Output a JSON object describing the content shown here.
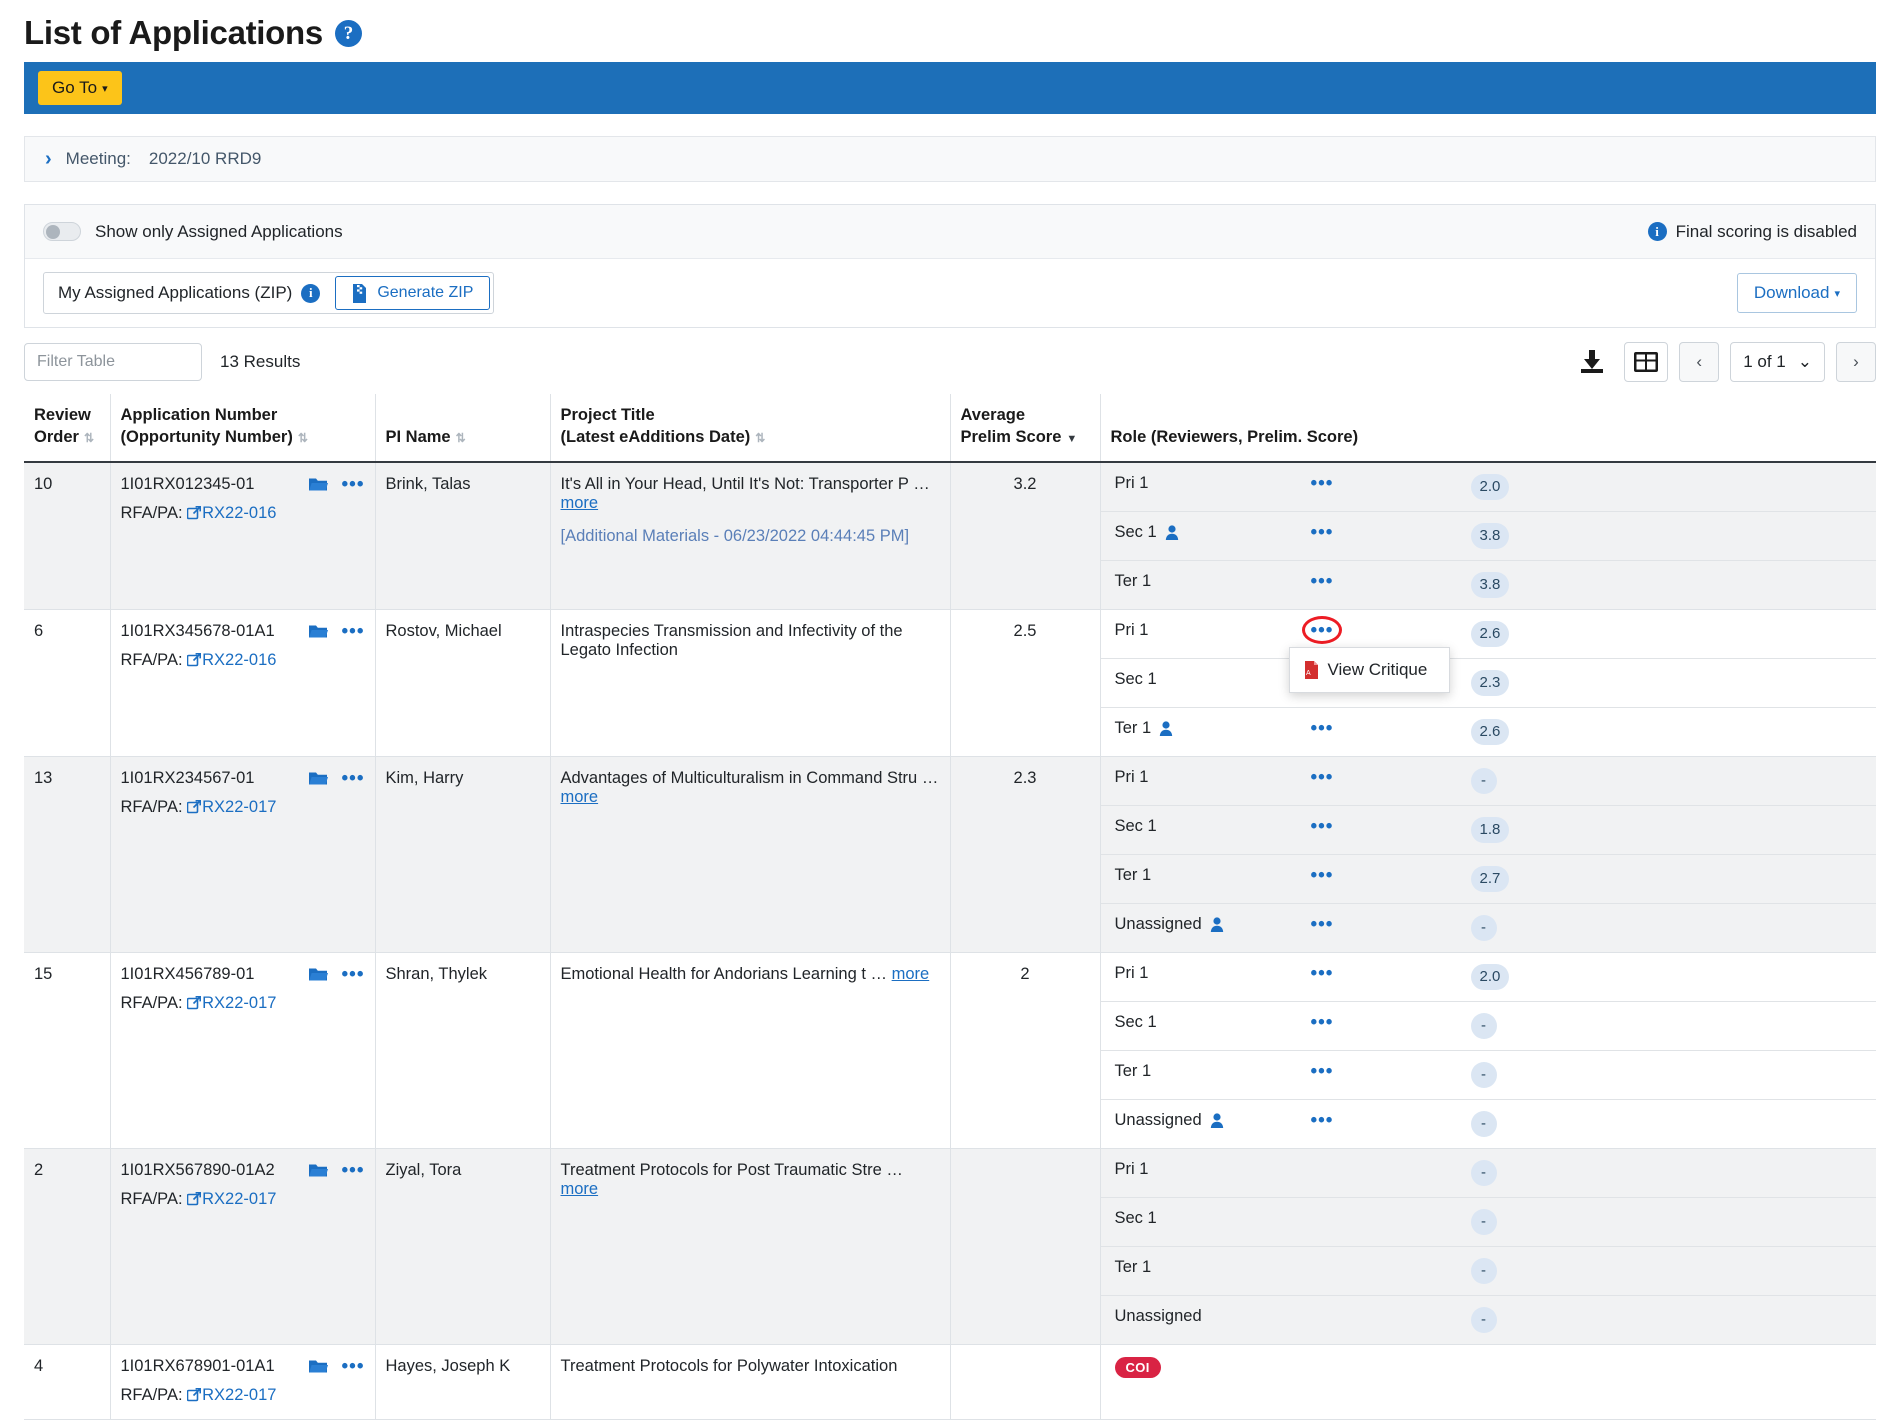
{
  "page": {
    "title": "List of Applications",
    "help_icon": "question-help-icon"
  },
  "navbar": {
    "goto_label": "Go To",
    "goto_caret": "▾"
  },
  "meeting": {
    "chevron": "›",
    "label": "Meeting:",
    "value": "2022/10 RRD9"
  },
  "options": {
    "show_assigned_label": "Show only Assigned Applications",
    "show_assigned_on": false,
    "final_scoring_note": "Final scoring is disabled",
    "zip_label": "My Assigned Applications (ZIP)",
    "generate_zip_label": "Generate ZIP",
    "download_label": "Download",
    "download_caret": "▾"
  },
  "filterbar": {
    "filter_placeholder": "Filter Table",
    "filter_value": "",
    "results_text": "13 Results",
    "page_indicator": "1 of 1",
    "prev_label": "‹",
    "next_label": "›",
    "page_caret": "⌄"
  },
  "table": {
    "headers": [
      {
        "line1": "Review",
        "line2": "Order",
        "sort": "both"
      },
      {
        "line1": "Application Number",
        "line2": "(Opportunity Number)",
        "sort": "both"
      },
      {
        "line1": "",
        "line2": "PI Name",
        "sort": "both"
      },
      {
        "line1": "Project Title",
        "line2": "(Latest eAdditions Date)",
        "sort": "both"
      },
      {
        "line1": "Average",
        "line2": "Prelim Score",
        "sort": "desc"
      },
      {
        "line1": "",
        "line2": "Role (Reviewers, Prelim. Score)",
        "sort": "none"
      }
    ],
    "rfa_prefix": "RFA/PA:",
    "more_label": "more",
    "rows": [
      {
        "review_order": "10",
        "app_number": "1I01RX012345-01",
        "rfa": "RX22-016",
        "pi_name": "Brink, Talas",
        "title": "It's All in Your Head, Until It's Not: Transporter P",
        "title_truncated": true,
        "additional_materials": "[Additional Materials - 06/23/2022 04:44:45 PM]",
        "avg_score": "3.2",
        "coi": false,
        "roles": [
          {
            "name": "Pri 1",
            "person": false,
            "dots": true,
            "score": "2.0"
          },
          {
            "name": "Sec 1",
            "person": true,
            "dots": true,
            "score": "3.8"
          },
          {
            "name": "Ter 1",
            "person": false,
            "dots": true,
            "score": "3.8"
          }
        ]
      },
      {
        "review_order": "6",
        "app_number": "1I01RX345678-01A1",
        "rfa": "RX22-016",
        "pi_name": "Rostov, Michael",
        "title": "Intraspecies Transmission and Infectivity of the Legato Infection",
        "title_truncated": false,
        "additional_materials": "",
        "avg_score": "2.5",
        "coi": false,
        "roles": [
          {
            "name": "Pri 1",
            "person": false,
            "dots": true,
            "score": "2.6",
            "highlight": true
          },
          {
            "name": "Sec 1",
            "person": false,
            "dots": false,
            "score": "2.3"
          },
          {
            "name": "Ter 1",
            "person": true,
            "dots": true,
            "score": "2.6"
          }
        ]
      },
      {
        "review_order": "13",
        "app_number": "1I01RX234567-01",
        "rfa": "RX22-017",
        "pi_name": "Kim, Harry",
        "title": "Advantages of Multiculturalism in Command Stru",
        "title_truncated": true,
        "additional_materials": "",
        "avg_score": "2.3",
        "coi": false,
        "roles": [
          {
            "name": "Pri 1",
            "person": false,
            "dots": true,
            "score": "-"
          },
          {
            "name": "Sec 1",
            "person": false,
            "dots": true,
            "score": "1.8"
          },
          {
            "name": "Ter 1",
            "person": false,
            "dots": true,
            "score": "2.7"
          },
          {
            "name": "Unassigned",
            "person": true,
            "dots": true,
            "score": "-"
          }
        ]
      },
      {
        "review_order": "15",
        "app_number": "1I01RX456789-01",
        "rfa": "RX22-017",
        "pi_name": "Shran, Thylek",
        "title": "Emotional Health for Andorians Learning t",
        "title_truncated": true,
        "additional_materials": "",
        "avg_score": "2",
        "coi": false,
        "roles": [
          {
            "name": "Pri 1",
            "person": false,
            "dots": true,
            "score": "2.0"
          },
          {
            "name": "Sec 1",
            "person": false,
            "dots": true,
            "score": "-"
          },
          {
            "name": "Ter 1",
            "person": false,
            "dots": true,
            "score": "-"
          },
          {
            "name": "Unassigned",
            "person": true,
            "dots": true,
            "score": "-"
          }
        ]
      },
      {
        "review_order": "2",
        "app_number": "1I01RX567890-01A2",
        "rfa": "RX22-017",
        "pi_name": "Ziyal, Tora",
        "title": "Treatment Protocols for Post Traumatic Stre",
        "title_truncated": true,
        "additional_materials": "",
        "avg_score": "",
        "coi": false,
        "roles": [
          {
            "name": "Pri 1",
            "person": false,
            "dots": false,
            "score": "-"
          },
          {
            "name": "Sec 1",
            "person": false,
            "dots": false,
            "score": "-"
          },
          {
            "name": "Ter 1",
            "person": false,
            "dots": false,
            "score": "-"
          },
          {
            "name": "Unassigned",
            "person": false,
            "dots": false,
            "score": "-"
          }
        ]
      },
      {
        "review_order": "4",
        "app_number": "1I01RX678901-01A1",
        "rfa": "RX22-017",
        "pi_name": "Hayes, Joseph K",
        "title": "Treatment Protocols for Polywater Intoxication",
        "title_truncated": false,
        "additional_materials": "",
        "avg_score": "",
        "coi": true,
        "coi_label": "COI",
        "roles": []
      }
    ]
  },
  "popup": {
    "view_critique_label": "View Critique",
    "pdf_icon": "pdf-file-icon"
  },
  "colors": {
    "navbar_blue": "#1d6fb8",
    "goto_yellow": "#fcc419",
    "link_blue": "#1b6ec2",
    "coi_red": "#d92344",
    "pill_bg": "#dbe6f3",
    "highlight_ring": "#ed1c24"
  }
}
